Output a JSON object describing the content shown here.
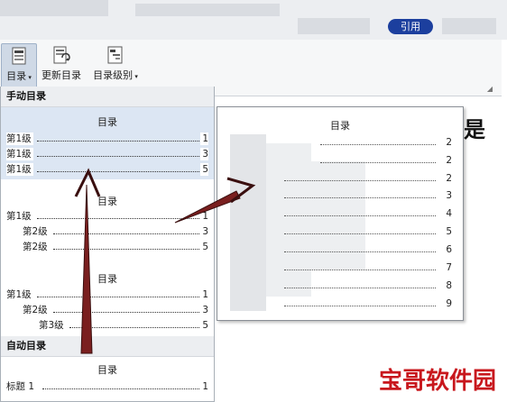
{
  "ribbon": {
    "active_tab": "引用",
    "buttons": [
      {
        "label": "目录",
        "icon": "toc-icon"
      },
      {
        "label": "更新目录",
        "icon": "update-toc-icon"
      },
      {
        "label": "目录级别",
        "icon": "toc-level-icon"
      }
    ]
  },
  "menu": {
    "manual_header": "手动目录",
    "auto_header": "自动目录",
    "tocs": [
      {
        "title": "目录",
        "lines": [
          {
            "label": "第1级",
            "page": "1"
          },
          {
            "label": "第1级",
            "page": "3"
          },
          {
            "label": "第1级",
            "page": "5"
          }
        ]
      },
      {
        "title": "目录",
        "lines": [
          {
            "label": "第1级",
            "page": "1"
          },
          {
            "label": "第2级",
            "page": "3"
          },
          {
            "label": "第2级",
            "page": "5"
          }
        ]
      },
      {
        "title": "目录",
        "lines": [
          {
            "label": "第1级",
            "page": "1"
          },
          {
            "label": "第2级",
            "page": "3"
          },
          {
            "label": "第3级",
            "page": "5"
          }
        ]
      }
    ],
    "auto_toc": {
      "title": "目录",
      "lines": [
        {
          "label": "标题 1",
          "page": "1"
        }
      ]
    }
  },
  "preview": {
    "title": "目录",
    "pages": [
      "2",
      "2",
      "2",
      "3",
      "4",
      "5",
      "6",
      "7",
      "8",
      "9"
    ]
  },
  "side_char": "是",
  "watermark": "宝哥软件园",
  "colors": {
    "accent": "#1c3f9e",
    "arrow": "#7a1f1f",
    "selection": "#dce6f3",
    "watermark": "#c8171d"
  }
}
